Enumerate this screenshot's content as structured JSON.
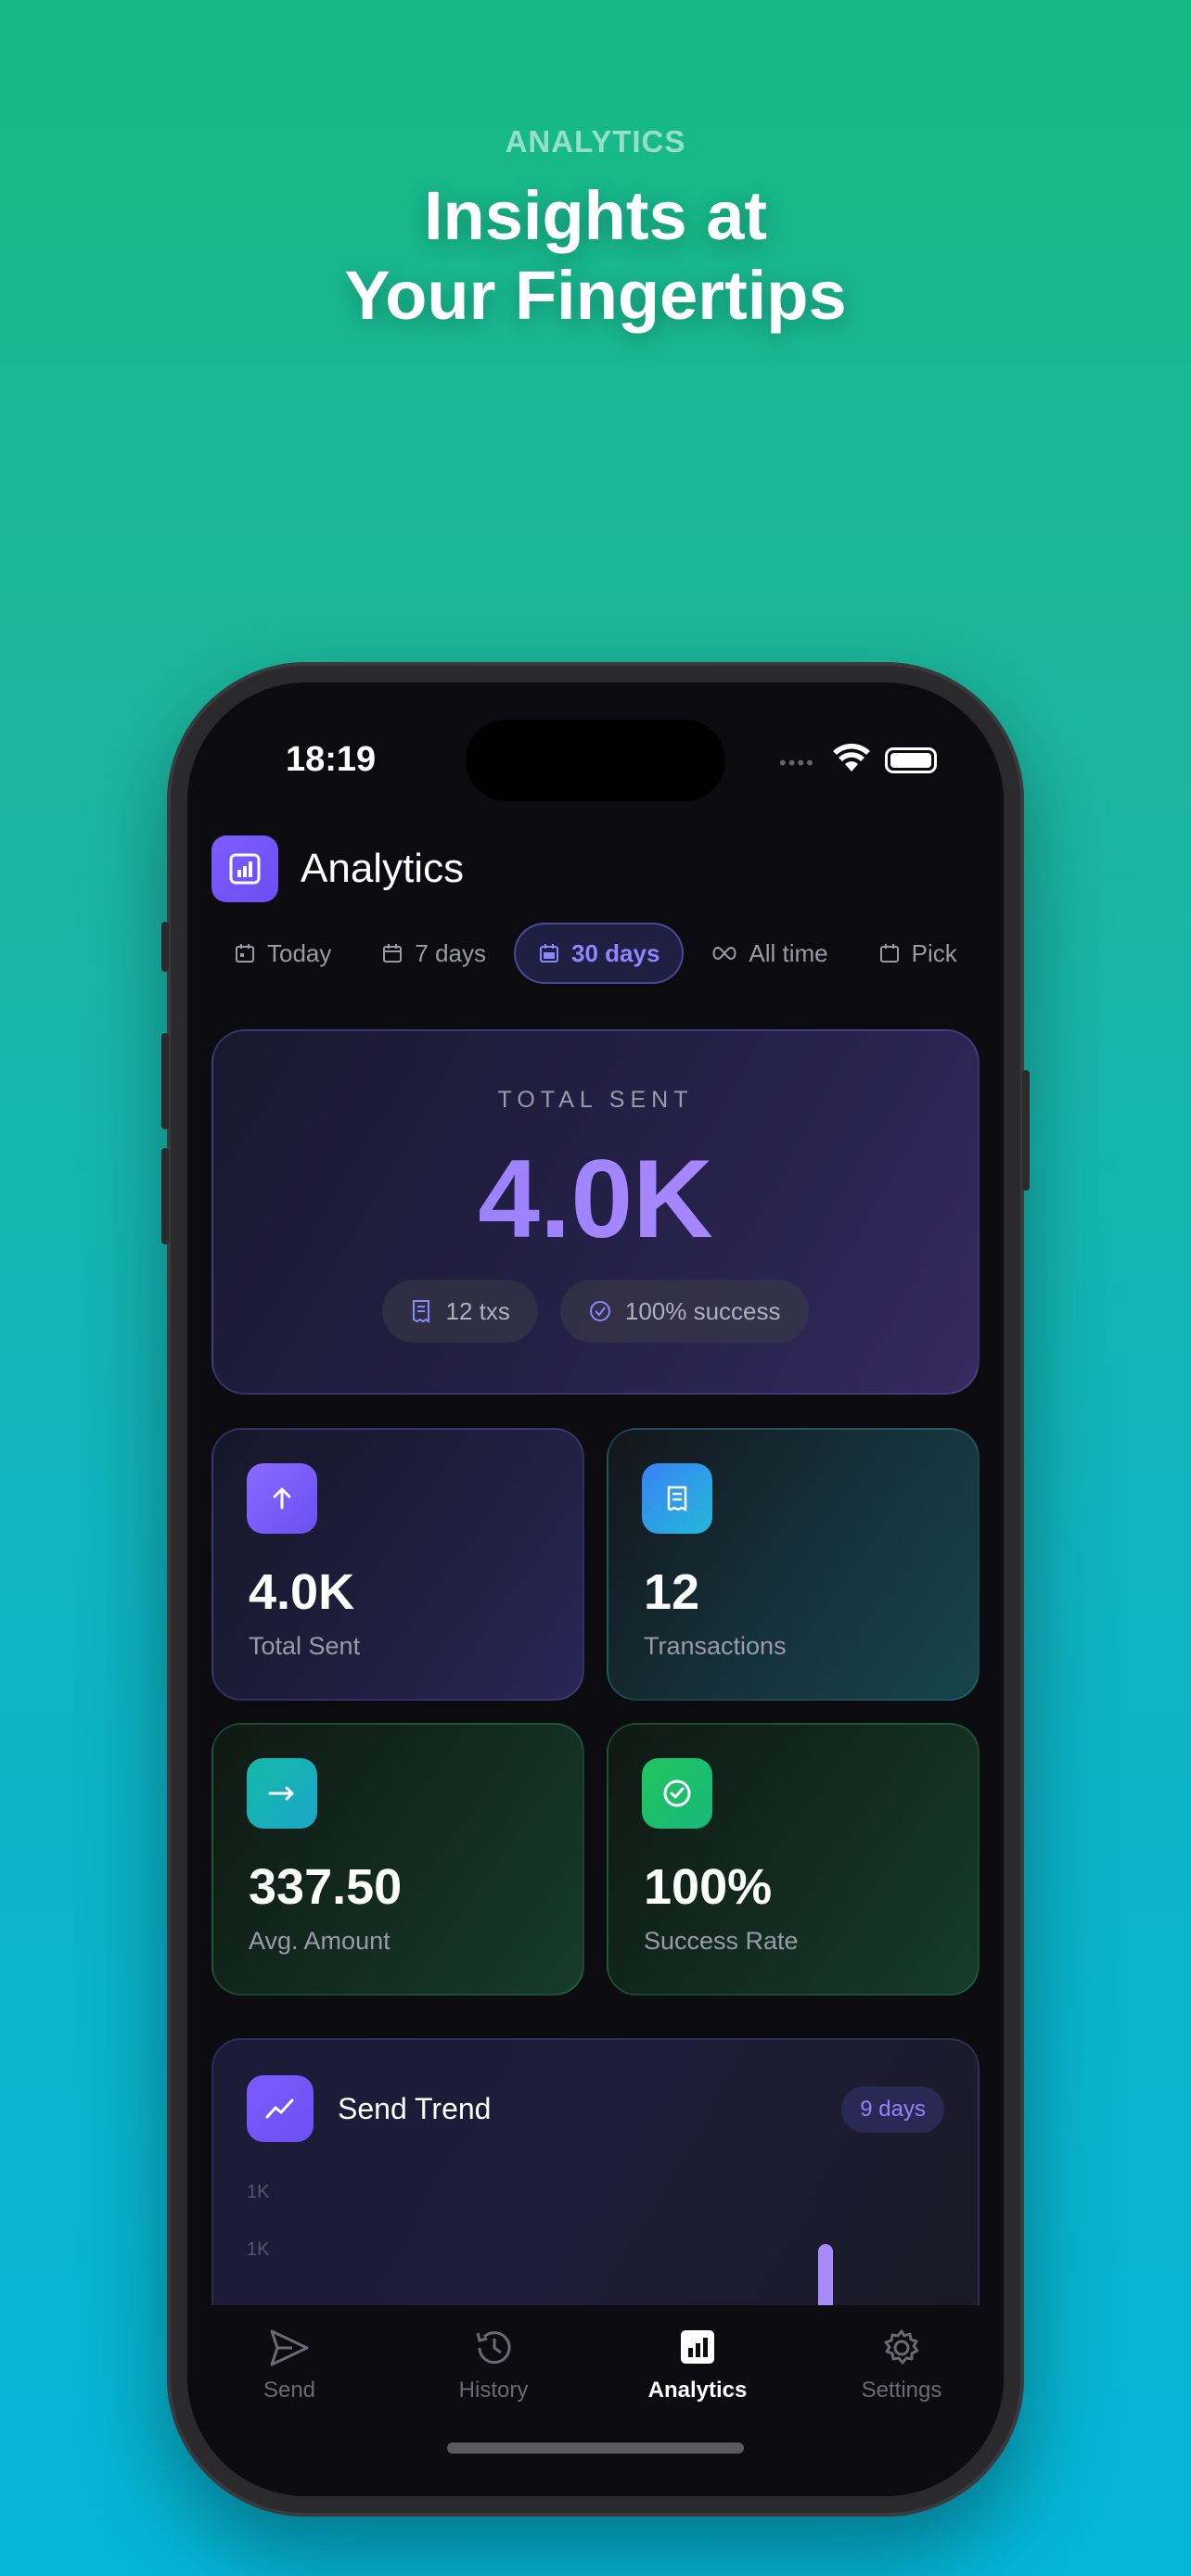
{
  "marketing": {
    "eyebrow": "ANALYTICS",
    "headline_line1": "Insights at",
    "headline_line2": "Your Fingertips"
  },
  "status_bar": {
    "time": "18:19"
  },
  "header": {
    "title": "Analytics",
    "icon": "bar-chart-icon"
  },
  "filters": [
    {
      "label": "Today",
      "icon": "calendar-day-icon",
      "active": false
    },
    {
      "label": "7 days",
      "icon": "calendar-week-icon",
      "active": false
    },
    {
      "label": "30 days",
      "icon": "calendar-month-icon",
      "active": true
    },
    {
      "label": "All time",
      "icon": "infinity-icon",
      "active": false
    },
    {
      "label": "Pick",
      "icon": "calendar-edit-icon",
      "active": false
    }
  ],
  "total": {
    "label": "TOTAL SENT",
    "value": "4.0K",
    "txs_pill": "12 txs",
    "success_pill": "100% success"
  },
  "stats": [
    {
      "value": "4.0K",
      "label": "Total Sent",
      "icon": "arrow-up-icon"
    },
    {
      "value": "12",
      "label": "Transactions",
      "icon": "receipt-icon"
    },
    {
      "value": "337.50",
      "label": "Avg. Amount",
      "icon": "arrow-right-icon"
    },
    {
      "value": "100%",
      "label": "Success Rate",
      "icon": "check-circle-icon"
    }
  ],
  "trend": {
    "title": "Send Trend",
    "badge": "9 days",
    "icon": "trend-line-icon"
  },
  "chart_data": {
    "type": "bar",
    "title": "Send Trend",
    "y_tick_labels": [
      "1K",
      "1K"
    ],
    "bars_visible_count": 1
  },
  "tabs": [
    {
      "label": "Send",
      "icon": "send-icon",
      "active": false
    },
    {
      "label": "History",
      "icon": "history-icon",
      "active": false
    },
    {
      "label": "Analytics",
      "icon": "analytics-icon",
      "active": true
    },
    {
      "label": "Settings",
      "icon": "gear-icon",
      "active": false
    }
  ],
  "colors": {
    "accent": "#7c5cff",
    "teal": "#14b8a6",
    "green": "#22c55e",
    "blue": "#3b82f6",
    "background_top": "#16b884",
    "background_bottom": "#05b5d6"
  }
}
